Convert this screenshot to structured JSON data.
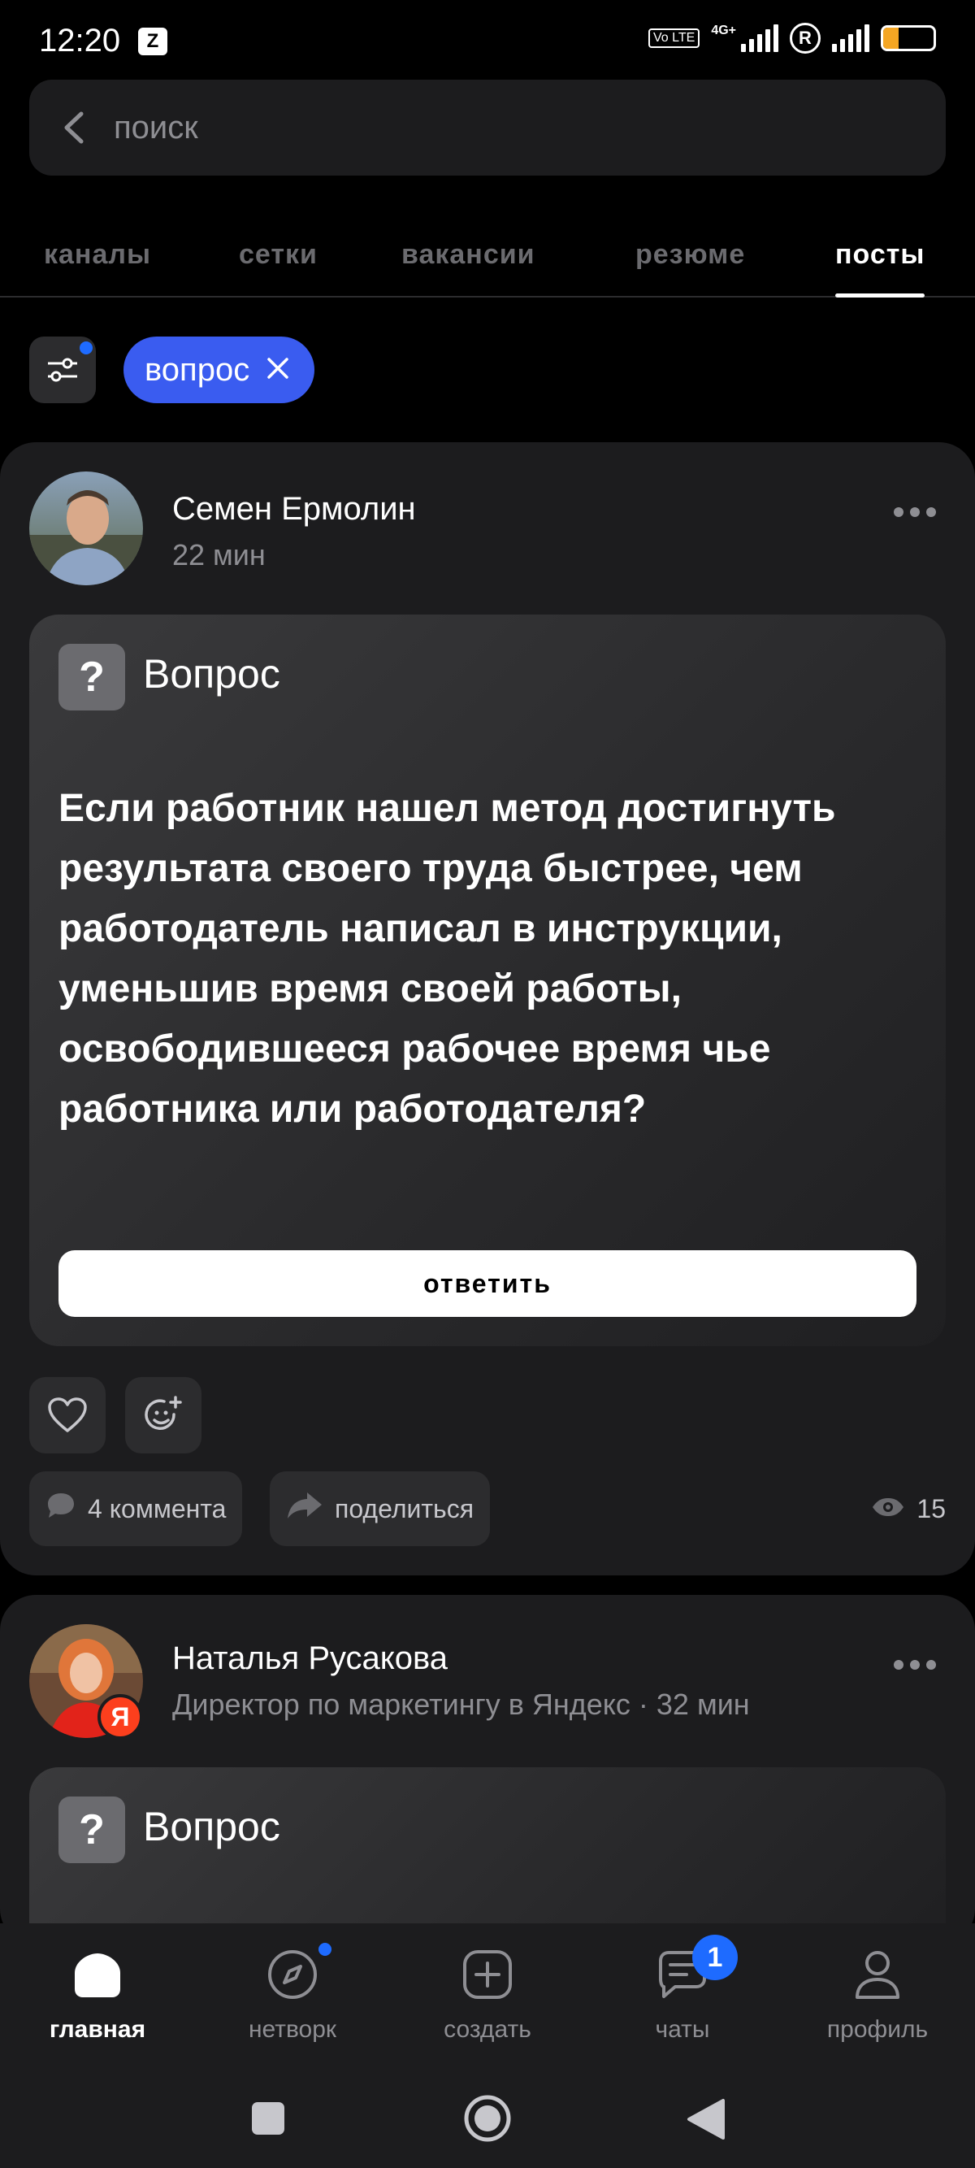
{
  "status_bar": {
    "time": "12:20",
    "app_icon": "Z",
    "volte": "Vo LTE",
    "network": "4G+",
    "roaming": "R",
    "battery": "30",
    "battery_level": 0.3,
    "battery_color": "#f5a623"
  },
  "search": {
    "placeholder": "поиск"
  },
  "tabs": [
    {
      "label": "каналы",
      "active": false
    },
    {
      "label": "сетки",
      "active": false
    },
    {
      "label": "вакансии",
      "active": false
    },
    {
      "label": "резюме",
      "active": false
    },
    {
      "label": "посты",
      "active": true
    }
  ],
  "filters": {
    "chip_label": "вопрос",
    "chip_color": "#3a5cf0",
    "indicator_color": "#1e6bff"
  },
  "posts": [
    {
      "author": "Семен Ермолин",
      "meta": "22 мин",
      "type_label": "Вопрос",
      "type_icon": "?",
      "text": "Если работник нашел метод достигнуть результата своего труда быстрее, чем работодатель написал в инструкции, уменьшив время своей работы, освободившееся рабочее время чье работника или работодателя?",
      "answer_label": "ответить",
      "comments": "4 коммента",
      "share": "поделиться",
      "views": "15"
    },
    {
      "author": "Наталья Русакова",
      "meta": "Директор по маркетингу в Яндекс · 32 мин",
      "badge": "Я",
      "type_label": "Вопрос",
      "type_icon": "?"
    }
  ],
  "bottom_nav": [
    {
      "label": "главная",
      "icon": "home-icon",
      "active": true
    },
    {
      "label": "нетворк",
      "icon": "compass-icon",
      "active": false,
      "dot": true
    },
    {
      "label": "создать",
      "icon": "plus-square-icon",
      "active": false
    },
    {
      "label": "чаты",
      "icon": "chat-icon",
      "active": false,
      "badge": "1"
    },
    {
      "label": "профиль",
      "icon": "profile-icon",
      "active": false
    }
  ]
}
